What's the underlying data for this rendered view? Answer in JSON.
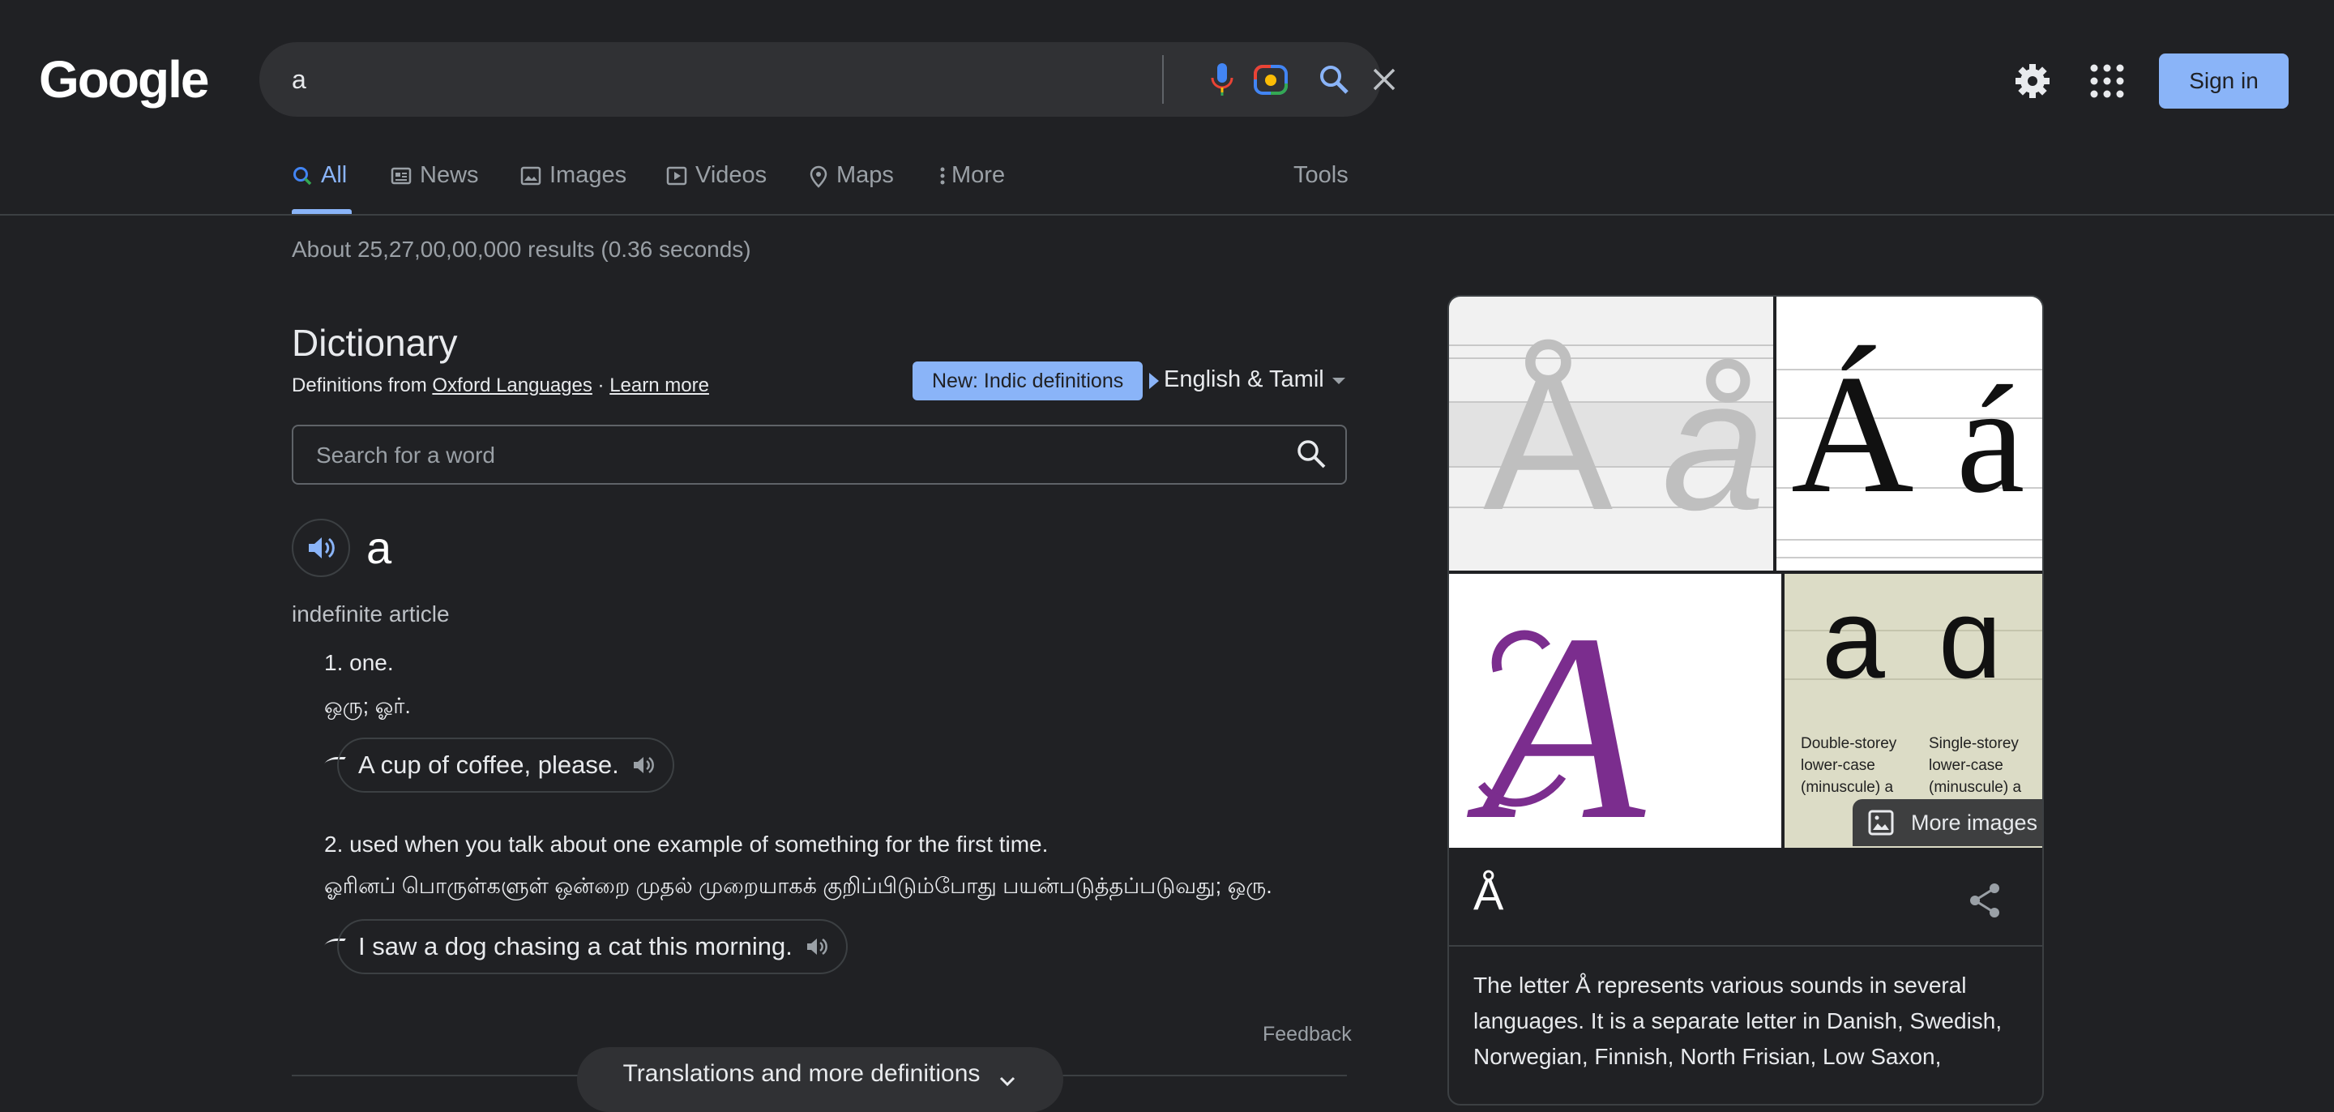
{
  "header": {
    "logo": "Google",
    "query": "a",
    "sign_in": "Sign in"
  },
  "tabs": [
    {
      "label": "All",
      "icon": "search-icon",
      "active": true
    },
    {
      "label": "News",
      "icon": "news-icon"
    },
    {
      "label": "Images",
      "icon": "image-icon"
    },
    {
      "label": "Videos",
      "icon": "video-icon"
    },
    {
      "label": "Maps",
      "icon": "map-pin-icon"
    },
    {
      "label": "More",
      "icon": "more-vert-icon"
    }
  ],
  "tools": "Tools",
  "results_stats": "About 25,27,00,00,000 results (0.36 seconds)",
  "dictionary": {
    "title": "Dictionary",
    "source_prefix": "Definitions from ",
    "source_link": "Oxford Languages",
    "separator": " · ",
    "learn_more": "Learn more",
    "new_badge": "New: Indic definitions",
    "language": "English & Tamil",
    "search_placeholder": "Search for a word",
    "headword": "a",
    "part_of_speech": "indefinite article",
    "definitions": [
      {
        "text": "1. one.",
        "tamil": "ஒரு; ஓர்.",
        "example": "A cup of coffee, please."
      },
      {
        "text": "2. used when you talk about one example of something for the first time.",
        "tamil": "ஓரினப் பொருள்களுள் ஒன்றை முதல் முறையாகக் குறிப்பிடும்போது பயன்படுத்தப்படுவது; ஒரு.",
        "example": "I saw a dog chasing a cat this morning."
      }
    ],
    "feedback": "Feedback",
    "more_definitions": "Translations and more definitions"
  },
  "knowledge_panel": {
    "image_texts": {
      "tile1": [
        "Å",
        "å"
      ],
      "tile2": [
        "Á",
        "á"
      ],
      "tile3": "A",
      "tile4_glyphs": [
        "a",
        "ɑ"
      ],
      "tile4_captions": [
        "Double-storey lower-case (minuscule) a",
        "Single-storey lower-case (minuscule) a"
      ]
    },
    "more_images": "More images",
    "title": "Å",
    "description": "The letter Å represents various sounds in several languages. It is a separate letter in Danish, Swedish, Norwegian, Finnish, North Frisian, Low Saxon,"
  },
  "colors": {
    "background": "#202124",
    "accent": "#8ab4f8",
    "surface": "#303134"
  }
}
